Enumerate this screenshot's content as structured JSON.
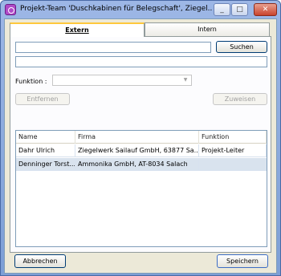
{
  "window": {
    "title": "Projekt-Team 'Duschkabinen für Belegschaft', Ziegel...",
    "minimize_glyph": "_",
    "maximize_glyph": "□",
    "close_glyph": "✕"
  },
  "tabs": [
    {
      "label": "Extern",
      "active": true
    },
    {
      "label": "Intern",
      "active": false
    }
  ],
  "search": {
    "value": "",
    "button_label": "Suchen",
    "second_field_value": ""
  },
  "funktion": {
    "label": "Funktion :",
    "selected": ""
  },
  "actions": {
    "remove_label": "Entfernen",
    "assign_label": "Zuweisen"
  },
  "table": {
    "columns": [
      "Name",
      "Firma",
      "Funktion"
    ],
    "rows": [
      {
        "name": "Dahr Ulrich",
        "firma": "Ziegelwerk Sailauf GmbH, 63877 Sa...",
        "funktion": "Projekt-Leiter"
      },
      {
        "name": "Denninger Torst...",
        "firma": "Ammonika GmbH, AT-8034 Salach",
        "funktion": ""
      }
    ]
  },
  "footer": {
    "cancel_label": "Abbrechen",
    "save_label": "Speichern"
  },
  "colors": {
    "titlebar": "#9db7e6",
    "tab_highlight": "#ffc83c",
    "selected_row": "#d9e3ee"
  }
}
